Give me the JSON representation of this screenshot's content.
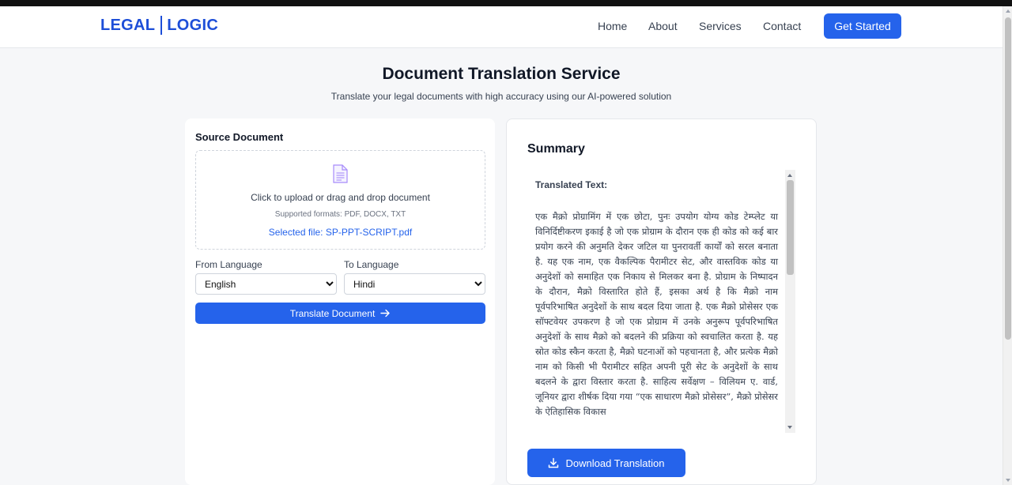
{
  "brand": {
    "left": "LEGAL",
    "right": "LOGIC",
    "accent_color": "#1d4ed8"
  },
  "nav": {
    "links": [
      "Home",
      "About",
      "Services",
      "Contact"
    ],
    "cta": "Get Started"
  },
  "page": {
    "title": "Document Translation Service",
    "subtitle": "Translate your legal documents with high accuracy using our AI-powered solution"
  },
  "source": {
    "heading": "Source Document",
    "upload_icon": "document-icon",
    "upload_text": "Click to upload or drag and drop document",
    "formats": "Supported formats: PDF, DOCX, TXT",
    "selected_file": "Selected file: SP-PPT-SCRIPT.pdf",
    "from_label": "From Language",
    "from_value": "English",
    "to_label": "To Language",
    "to_value": "Hindi",
    "translate_button": "Translate Document",
    "translate_icon": "arrow-right-icon"
  },
  "summary": {
    "heading": "Summary",
    "translated_label": "Translated Text:",
    "translated_text": "एक मैक्रो प्रोग्रामिंग में एक छोटा, पुनः उपयोग योग्य कोड टेम्प्लेट या विनिर्दिष्टीकरण इकाई है जो एक प्रोग्राम के दौरान एक ही कोड को कई बार प्रयोग करने की अनुमति देकर जटिल या पुनरावर्ती कार्यों को सरल बनाता है. यह एक नाम, एक वैकल्पिक पैरामीटर सेट, और वास्तविक कोड या अनुदेशों को समाहित एक निकाय से मिलकर बना है. प्रोग्राम के निष्पादन के दौरान, मैक्रो विस्तारित होते हैं, इसका अर्थ है कि मैक्रो नाम पूर्वपरिभाषित अनुदेशों के साथ बदल दिया जाता है. एक मैक्रो प्रोसेसर एक सॉफ्टवेयर उपकरण है जो एक प्रोग्राम में उनके अनुरूप पूर्वपरिभाषित अनुदेशों के साथ मैक्रो को बदलने की प्रक्रिया को स्वचालित करता है. यह स्रोत कोड स्कैन करता है, मैक्रो घटनाओं को पहचानता है, और प्रत्येक मैक्रो नाम को किसी भी पैरामीटर सहित अपनी पूरी सेट के अनुदेशों के साथ बदलने के द्वारा विस्तार करता है. साहित्य सर्वेक्षण – विलियम ए. वार्ड, जूनियर द्वारा शीर्षक दिया गया “एक साधारण मैक्रो प्रोसेसर”, मैक्रो प्रोसेसर के ऐतिहासिक विकास",
    "download_button": "Download Translation",
    "download_icon": "download-icon"
  }
}
